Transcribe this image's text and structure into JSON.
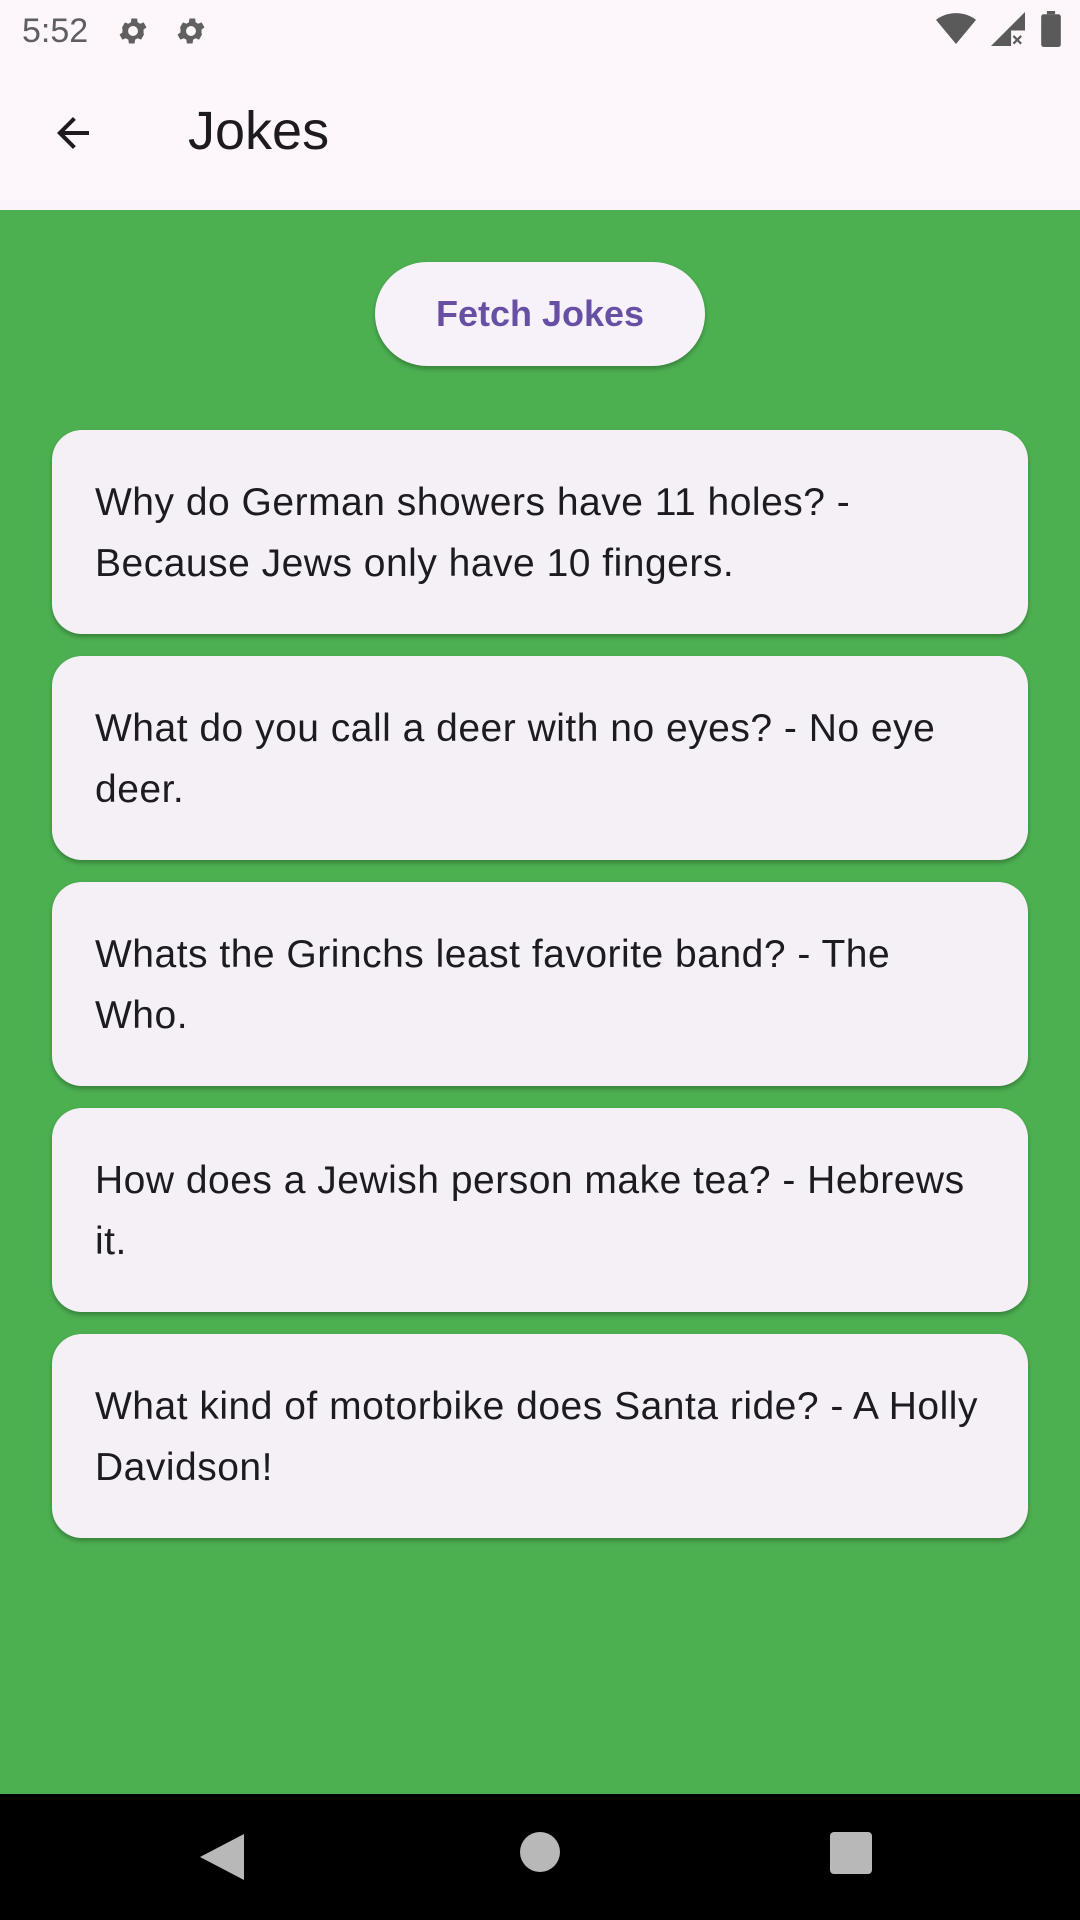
{
  "status_bar": {
    "time": "5:52",
    "icons": [
      "settings-icon",
      "settings-icon",
      "wifi-icon",
      "signal-icon",
      "battery-icon"
    ]
  },
  "app_bar": {
    "title": "Jokes",
    "back_icon": "arrow-back-icon"
  },
  "main": {
    "fetch_button_label": "Fetch Jokes",
    "jokes": [
      "Why do German showers have 11 holes? - Because Jews only have 10 fingers.",
      "What do you call a deer with no eyes? - No eye deer.",
      "Whats the Grinchs least favorite band? - The Who.",
      "How does a Jewish person make tea? - Hebrews it.",
      "What kind of motorbike does Santa ride? - A Holly Davidson!"
    ]
  },
  "nav_bar": {
    "icons": [
      "nav-back-icon",
      "nav-home-icon",
      "nav-recents-icon"
    ]
  },
  "colors": {
    "background": "#4caf50",
    "app_bar": "#fdf7fc",
    "card": "#f4f0f6",
    "accent": "#6750a4"
  }
}
